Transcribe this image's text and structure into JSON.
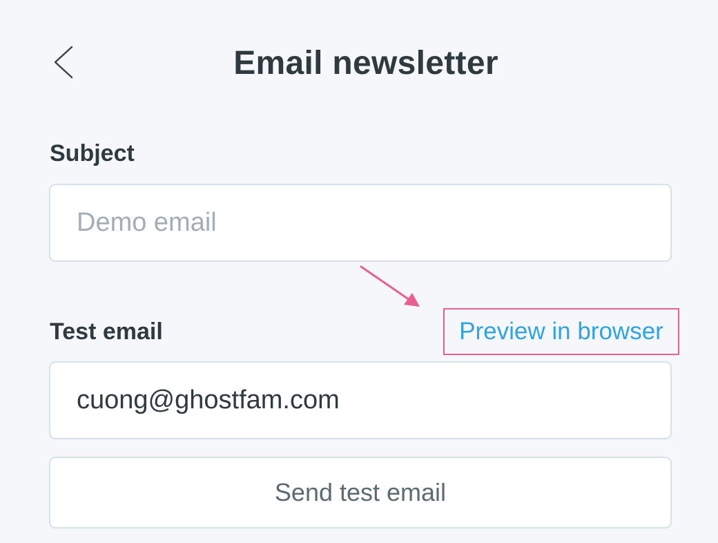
{
  "header": {
    "title": "Email newsletter",
    "back_icon": "chevron-left-icon"
  },
  "subject": {
    "label": "Subject",
    "placeholder": "Demo email",
    "value": ""
  },
  "test_email": {
    "label": "Test email",
    "value": "cuong@ghostfam.com",
    "preview_link": "Preview in browser",
    "send_button": "Send test email"
  },
  "colors": {
    "background": "#f5f7fb",
    "text": "#2f3a40",
    "link": "#2fa3e3",
    "highlight": "#e8608e",
    "border": "#d7e1e8"
  }
}
